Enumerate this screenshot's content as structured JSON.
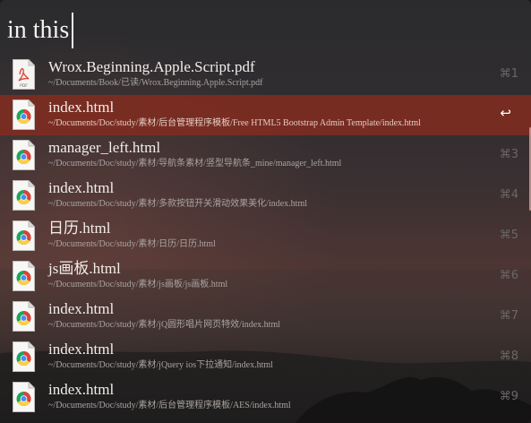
{
  "window": {
    "query": "in this"
  },
  "results": [
    {
      "title": "Wrox.Beginning.Apple.Script.pdf",
      "path": "~/Documents/Book/已读/Wrox.Beginning.Apple.Script.pdf",
      "shortcut": "⌘1",
      "icon": "pdf-file-icon",
      "icon_label": "PDF",
      "selected": false
    },
    {
      "title": "index.html",
      "path": "~/Documents/Doc/study/素材/后台管理程序模板/Free HTML5 Bootstrap Admin Template/index.html",
      "shortcut": "↩",
      "icon": "chrome-html-file-icon",
      "selected": true
    },
    {
      "title": "manager_left.html",
      "path": "~/Documents/Doc/study/素材/导航条素材/竖型导航条_mine/manager_left.html",
      "shortcut": "⌘3",
      "icon": "chrome-html-file-icon",
      "selected": false
    },
    {
      "title": "index.html",
      "path": "~/Documents/Doc/study/素材/多款按钮开关滑动效果美化/index.html",
      "shortcut": "⌘4",
      "icon": "chrome-html-file-icon",
      "selected": false
    },
    {
      "title": "日历.html",
      "path": "~/Documents/Doc/study/素材/日历/日历.html",
      "shortcut": "⌘5",
      "icon": "chrome-html-file-icon",
      "selected": false
    },
    {
      "title": "js画板.html",
      "path": "~/Documents/Doc/study/素材/js画板/js画板.html",
      "shortcut": "⌘6",
      "icon": "chrome-html-file-icon",
      "selected": false
    },
    {
      "title": "index.html",
      "path": "~/Documents/Doc/study/素材/jQ圆形唱片网页特效/index.html",
      "shortcut": "⌘7",
      "icon": "chrome-html-file-icon",
      "selected": false
    },
    {
      "title": "index.html",
      "path": "~/Documents/Doc/study/素材/jQuery ios下拉通知/index.html",
      "shortcut": "⌘8",
      "icon": "chrome-html-file-icon",
      "selected": false
    },
    {
      "title": "index.html",
      "path": "~/Documents/Doc/study/素材/后台管理程序模板/AES/index.html",
      "shortcut": "⌘9",
      "icon": "chrome-html-file-icon",
      "selected": false
    }
  ],
  "colors": {
    "selection": "#822C20",
    "text": "#F1EEEA",
    "subtext": "#A9A4A1",
    "shortcut": "#6B6766",
    "pdf_red": "#D94B3F"
  }
}
